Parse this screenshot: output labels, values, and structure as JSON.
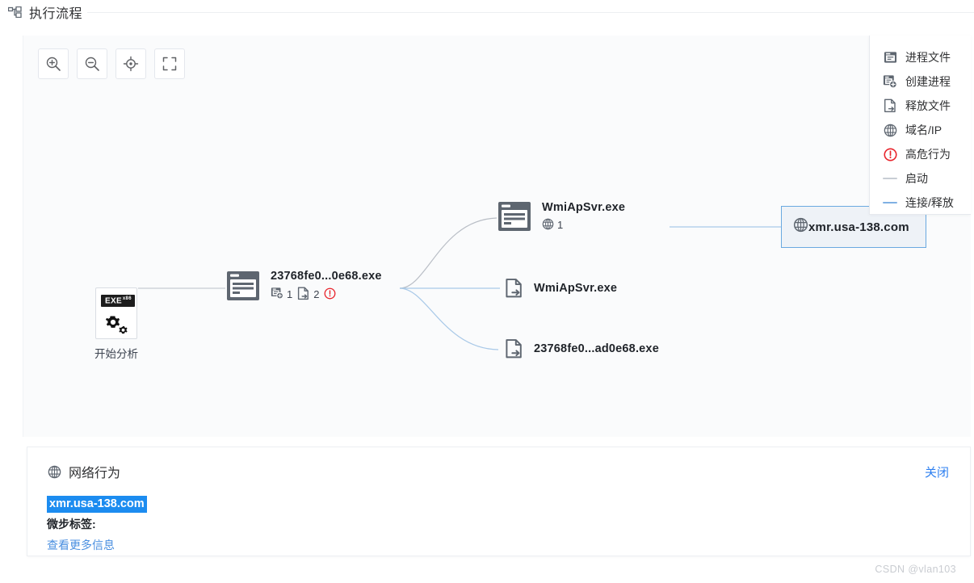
{
  "titlebar": {
    "icon": "sitemap-icon",
    "title": "执行流程"
  },
  "toolbar": {
    "buttons": [
      {
        "name": "zoom-in-button",
        "icon": "zoom-in-icon"
      },
      {
        "name": "zoom-out-button",
        "icon": "zoom-out-icon"
      },
      {
        "name": "recenter-button",
        "icon": "crosshair-icon"
      },
      {
        "name": "fullscreen-button",
        "icon": "fullscreen-icon"
      }
    ]
  },
  "legend": {
    "items": [
      {
        "label": "进程文件",
        "icon": "process-file-icon",
        "type": "icon"
      },
      {
        "label": "创建进程",
        "icon": "create-process-icon",
        "type": "icon"
      },
      {
        "label": "释放文件",
        "icon": "drop-file-icon",
        "type": "icon"
      },
      {
        "label": "域名/IP",
        "icon": "globe-icon",
        "type": "icon"
      },
      {
        "label": "高危行为",
        "icon": "danger-icon",
        "type": "icon"
      },
      {
        "label": "启动",
        "icon": "line-gray",
        "type": "line",
        "color": "#c8cdd4"
      },
      {
        "label": "连接/释放",
        "icon": "line-blue",
        "type": "line",
        "color": "#7fb0e3"
      }
    ]
  },
  "graph": {
    "start_node": {
      "label": "开始分析",
      "chip": "EXE",
      "chip_sub": "x86",
      "icon": "exe-gears-icon"
    },
    "main_process": {
      "label": "23768fe0...0e68.exe",
      "icon": "process-file-icon",
      "badges": [
        {
          "icon": "create-process-icon",
          "count": "1"
        },
        {
          "icon": "drop-file-icon",
          "count": "2"
        },
        {
          "icon": "danger-icon",
          "count": ""
        }
      ]
    },
    "child_process": {
      "label": "WmiApSvr.exe",
      "icon": "process-file-icon",
      "badges": [
        {
          "icon": "globe-icon",
          "count": "1"
        }
      ]
    },
    "dropped_file_1": {
      "label": "WmiApSvr.exe",
      "icon": "drop-file-icon"
    },
    "dropped_file_2": {
      "label": "23768fe0...ad0e68.exe",
      "icon": "drop-file-icon"
    },
    "domain_node": {
      "label": "xmr.usa-138.com",
      "icon": "globe-icon",
      "selected": true
    }
  },
  "info_panel": {
    "icon": "globe-icon",
    "title": "网络行为",
    "close_label": "关闭",
    "host": "xmr.usa-138.com",
    "tag_label": "微步标签:",
    "more_link": "查看更多信息"
  },
  "watermark": "CSDN @vlan103",
  "colors": {
    "accent_blue": "#2d7ff0",
    "selection_blue": "#1c8cf0",
    "edge_blue": "#7fb0e3",
    "edge_gray": "#c8cdd4",
    "danger_red": "#e8232b",
    "node_gray": "#5e6670",
    "selected_node_bg": "#eef2f7",
    "selected_node_border": "#6aa9e0"
  }
}
